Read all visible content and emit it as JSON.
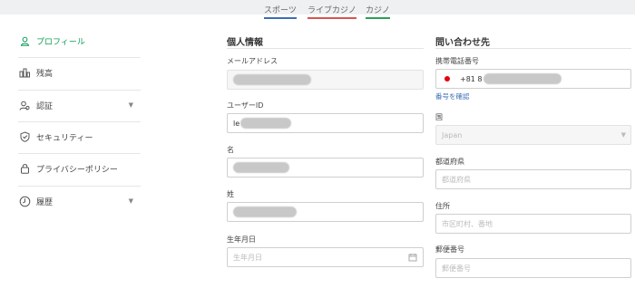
{
  "top_tabs": [
    {
      "label": "スポーツ",
      "underline": "#3b6fb6"
    },
    {
      "label": "ライブカジノ",
      "underline": "#d9534f"
    },
    {
      "label": "カジノ",
      "underline": "#2e9e57"
    }
  ],
  "sidebar": {
    "items": [
      {
        "label": "プロフィール",
        "icon": "user-icon",
        "active": true
      },
      {
        "label": "残高",
        "icon": "balance-icon"
      },
      {
        "label": "認証",
        "icon": "verify-icon",
        "expandable": true
      },
      {
        "label": "セキュリティー",
        "icon": "shield-icon"
      },
      {
        "label": "プライバシーポリシー",
        "icon": "lock-icon"
      },
      {
        "label": "履歴",
        "icon": "clock-icon",
        "expandable": true
      }
    ]
  },
  "personal": {
    "title": "個人情報",
    "email_label": "メールアドレス",
    "userid_label": "ユーザーID",
    "userid_prefix": "le",
    "first_name_label": "名",
    "last_name_label": "姓",
    "birthdate_label": "生年月日",
    "birthdate_placeholder": "生年月日"
  },
  "contact": {
    "title": "問い合わせ先",
    "phone_label": "携帯電話番号",
    "phone_prefix": "+81 8",
    "verify_link": "番号を確認",
    "country_label": "国",
    "country_value": "Japan",
    "prefecture_label": "都道府県",
    "prefecture_placeholder": "都道府県",
    "address_label": "住所",
    "address_placeholder": "市区町村、番地",
    "postal_label": "郵便番号",
    "postal_placeholder": "郵便番号"
  },
  "colors": {
    "accent": "#0f9d58",
    "link": "#3b6fb6"
  }
}
